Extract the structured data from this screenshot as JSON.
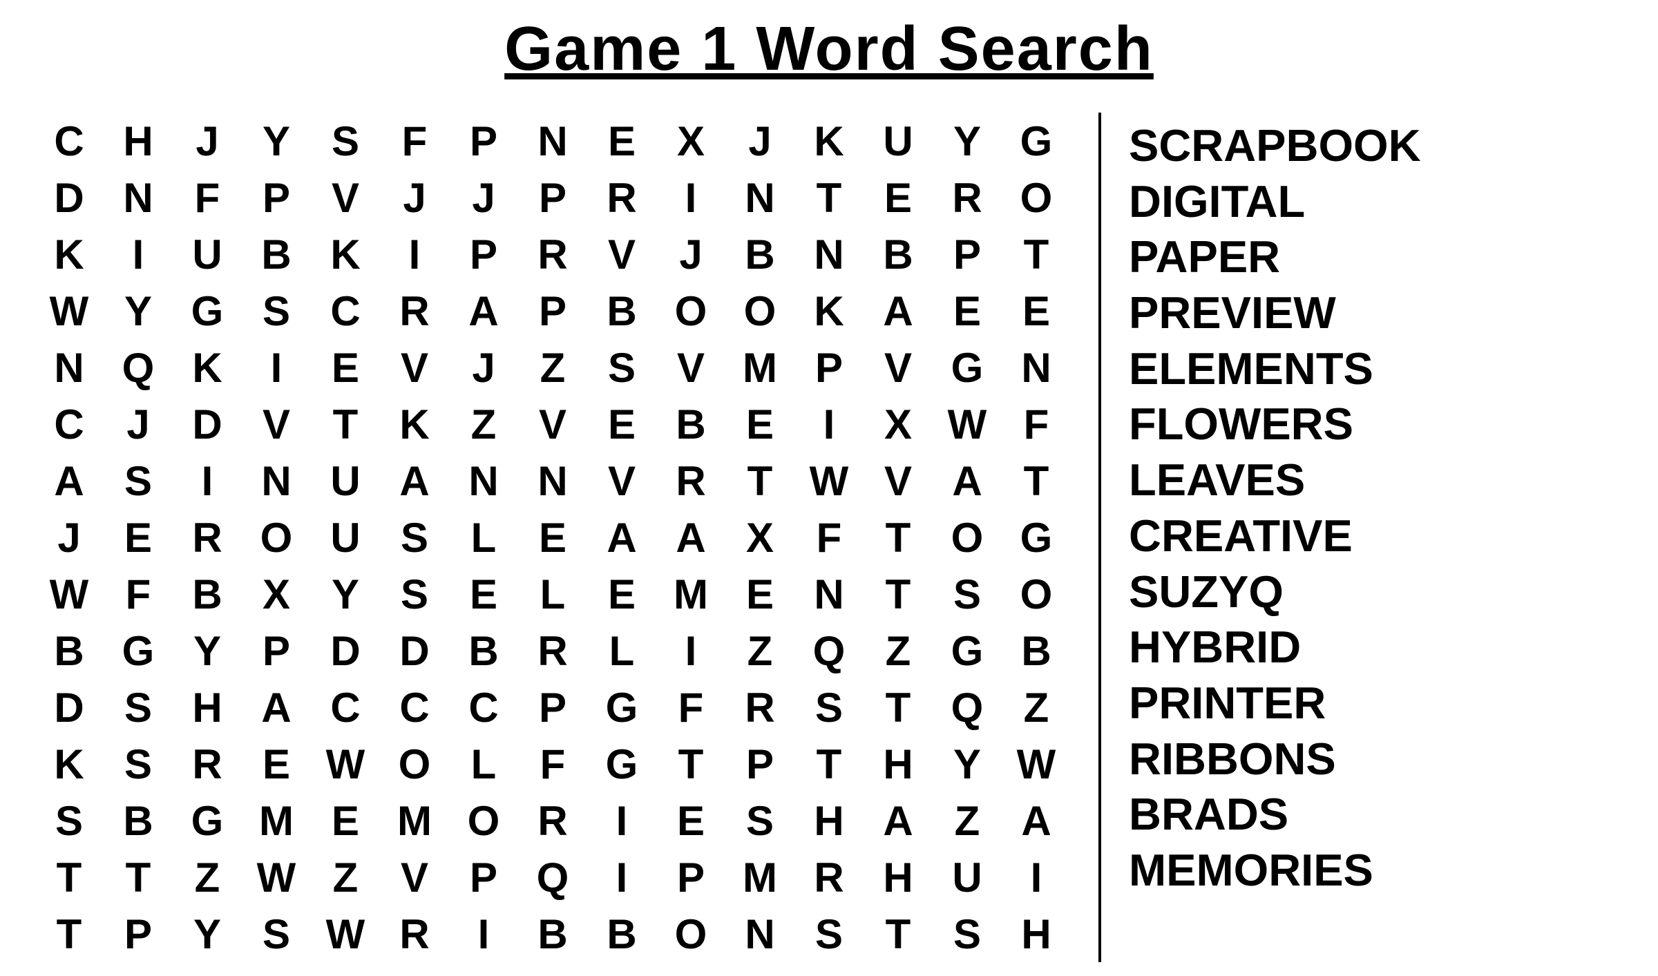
{
  "title": "Game 1 Word Search",
  "grid": [
    [
      "C",
      "H",
      "J",
      "Y",
      "S",
      "F",
      "P",
      "N",
      "E",
      "X",
      "J",
      "K",
      "U",
      "Y",
      "G"
    ],
    [
      "D",
      "N",
      "F",
      "P",
      "V",
      "J",
      "J",
      "P",
      "R",
      "I",
      "N",
      "T",
      "E",
      "R",
      "O"
    ],
    [
      "K",
      "I",
      "U",
      "B",
      "K",
      "I",
      "P",
      "R",
      "V",
      "J",
      "B",
      "N",
      "B",
      "P",
      "T"
    ],
    [
      "W",
      "Y",
      "G",
      "S",
      "C",
      "R",
      "A",
      "P",
      "B",
      "O",
      "O",
      "K",
      "A",
      "E",
      "E"
    ],
    [
      "N",
      "Q",
      "K",
      "I",
      "E",
      "V",
      "J",
      "Z",
      "S",
      "V",
      "M",
      "P",
      "V",
      "G",
      "N"
    ],
    [
      "C",
      "J",
      "D",
      "V",
      "T",
      "K",
      "Z",
      "V",
      "E",
      "B",
      "E",
      "I",
      "X",
      "W",
      "F"
    ],
    [
      "A",
      "S",
      "I",
      "N",
      "U",
      "A",
      "N",
      "N",
      "V",
      "R",
      "T",
      "W",
      "V",
      "A",
      "T"
    ],
    [
      "J",
      "E",
      "R",
      "O",
      "U",
      "S",
      "L",
      "E",
      "A",
      "A",
      "X",
      "F",
      "T",
      "O",
      "G"
    ],
    [
      "W",
      "F",
      "B",
      "X",
      "Y",
      "S",
      "E",
      "L",
      "E",
      "M",
      "E",
      "N",
      "T",
      "S",
      "O"
    ],
    [
      "B",
      "G",
      "Y",
      "P",
      "D",
      "D",
      "B",
      "R",
      "L",
      "I",
      "Z",
      "Q",
      "Z",
      "G",
      "B"
    ],
    [
      "D",
      "S",
      "H",
      "A",
      "C",
      "C",
      "C",
      "P",
      "G",
      "F",
      "R",
      "S",
      "T",
      "Q",
      "Z"
    ],
    [
      "K",
      "S",
      "R",
      "E",
      "W",
      "O",
      "L",
      "F",
      "G",
      "T",
      "P",
      "T",
      "H",
      "Y",
      "W"
    ],
    [
      "S",
      "B",
      "G",
      "M",
      "E",
      "M",
      "O",
      "R",
      "I",
      "E",
      "S",
      "H",
      "A",
      "Z",
      "A"
    ],
    [
      "T",
      "T",
      "Z",
      "W",
      "Z",
      "V",
      "P",
      "Q",
      "I",
      "P",
      "M",
      "R",
      "H",
      "U",
      "I"
    ],
    [
      "T",
      "P",
      "Y",
      "S",
      "W",
      "R",
      "I",
      "B",
      "B",
      "O",
      "N",
      "S",
      "T",
      "S",
      "H"
    ]
  ],
  "words": [
    "SCRAPBOOK",
    "DIGITAL",
    "PAPER",
    "PREVIEW",
    "ELEMENTS",
    "FLOWERS",
    "LEAVES",
    "CREATIVE",
    "SUZYQ",
    "HYBRID",
    "PRINTER",
    "RIBBONS",
    "BRADS",
    "MEMORIES"
  ]
}
